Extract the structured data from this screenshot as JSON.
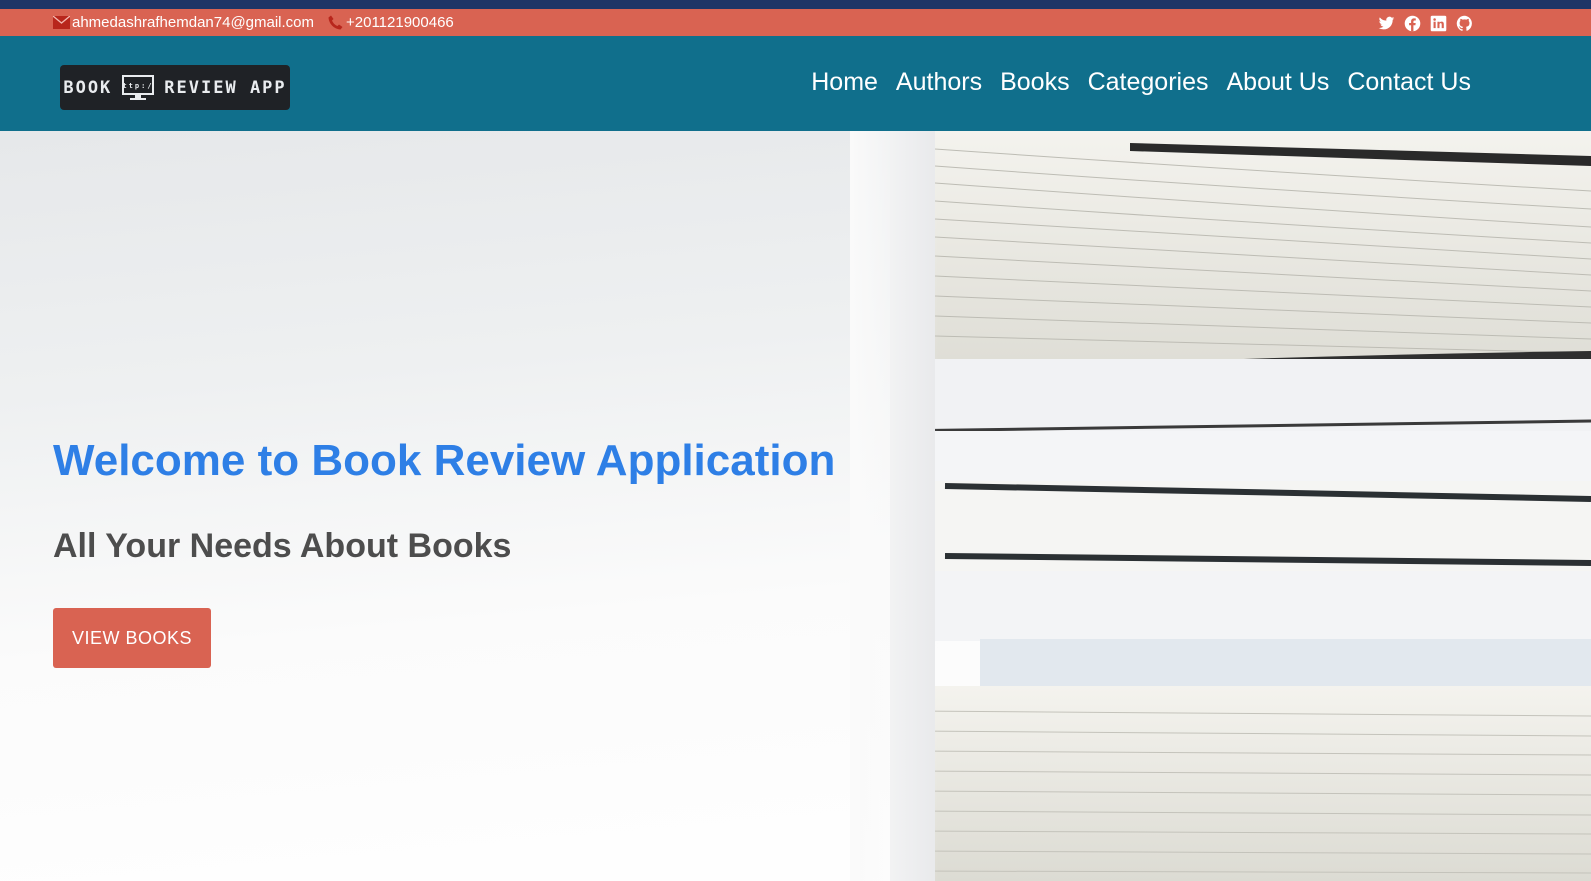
{
  "contact": {
    "email": "ahmedashrafhemdan74@gmail.com",
    "phone": "+201121900466"
  },
  "social": [
    "twitter-icon",
    "facebook-icon",
    "linkedin-icon",
    "github-icon"
  ],
  "logo": {
    "text_left": "BOOK",
    "screen_text": "http://",
    "text_right": "REVIEW APP"
  },
  "nav": {
    "home": "Home",
    "authors": "Authors",
    "books": "Books",
    "categories": "Categories",
    "about": "About Us",
    "contact": "Contact Us"
  },
  "hero": {
    "title": "Welcome to Book Review Application",
    "subtitle": "All Your Needs About Books",
    "button": "VIEW BOOKS"
  },
  "colors": {
    "top_strip": "#1f3566",
    "accent": "#d96352",
    "navbar": "#106f8c",
    "title": "#2e7fe6"
  }
}
